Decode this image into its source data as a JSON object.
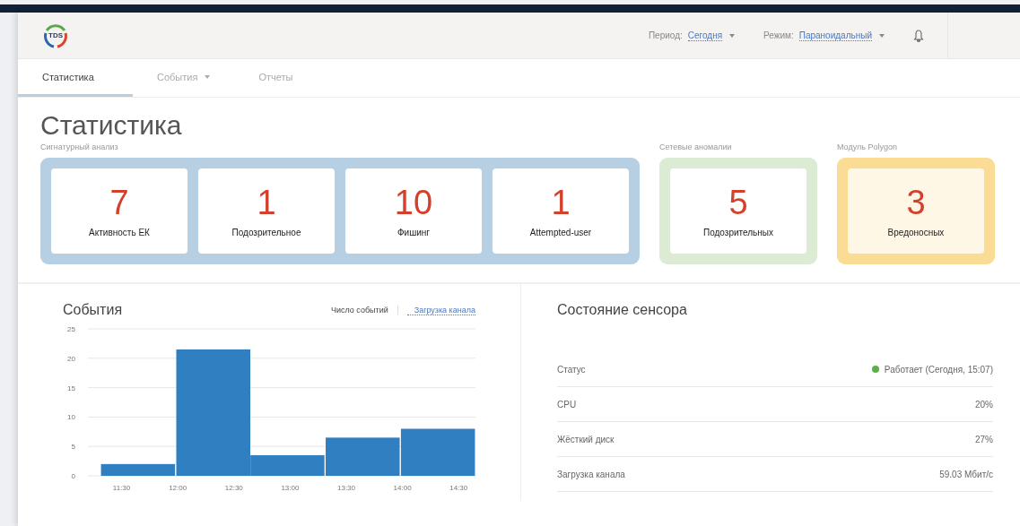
{
  "header": {
    "logo_text": "TDS",
    "period": {
      "label": "Период:",
      "value": "Сегодня"
    },
    "mode": {
      "label": "Режим:",
      "value": "Параноидальный"
    }
  },
  "tabs": [
    {
      "label": "Статистика",
      "selected": true,
      "dropdown": false
    },
    {
      "label": "События",
      "selected": false,
      "dropdown": true
    },
    {
      "label": "Отчеты",
      "selected": false,
      "dropdown": false
    }
  ],
  "page_title": "Статистика",
  "groups": [
    {
      "title": "Сигнатурный анализ",
      "color": "#b7cfe2",
      "cards": [
        {
          "value": "7",
          "label": "Активность ЕК"
        },
        {
          "value": "1",
          "label": "Подозрительное"
        },
        {
          "value": "10",
          "label": "Фишинг"
        },
        {
          "value": "1",
          "label": "Attempted-user"
        }
      ]
    },
    {
      "title": "Сетевые аномалии",
      "color": "#dcebd3",
      "cards": [
        {
          "value": "5",
          "label": "Подозрительных"
        }
      ]
    },
    {
      "title": "Модуль Polygon",
      "color": "#fbdc95",
      "cards": [
        {
          "value": "3",
          "label": "Вредоносных"
        }
      ]
    }
  ],
  "events": {
    "title": "События",
    "toggles": [
      {
        "label": "Число событий",
        "selected": true
      },
      {
        "label": "Загрузка канала",
        "selected": false
      }
    ],
    "chart_data": {
      "type": "bar",
      "x": [
        11.65,
        12.32,
        12.98,
        13.65,
        14.32
      ],
      "series": [
        {
          "color": "#2f7fc1",
          "values": [
            2,
            21.5,
            3.5,
            6.5,
            8
          ]
        }
      ],
      "grid": true,
      "xlim": [
        11.2,
        14.65
      ],
      "ylim": [
        0,
        25
      ],
      "xticks": [
        {
          "value": 11.5,
          "label": "11:30"
        },
        {
          "value": 12,
          "label": "12:00"
        },
        {
          "value": 12.5,
          "label": "12:30"
        },
        {
          "value": 13,
          "label": "13:00"
        },
        {
          "value": 13.5,
          "label": "13:30"
        },
        {
          "value": 14,
          "label": "14:00"
        },
        {
          "value": 14.5,
          "label": "14:30"
        }
      ],
      "yticks": [
        0,
        5,
        10,
        15,
        20,
        25
      ]
    }
  },
  "sensor": {
    "title": "Состояние сенсора",
    "rows": [
      {
        "kind": "status",
        "label": "Статус",
        "value": "Работает (Сегодня, 15:07)",
        "color": "#5cb04a"
      },
      {
        "kind": "plain",
        "label": "CPU",
        "value": "20%"
      },
      {
        "kind": "plain",
        "label": "Жёсткий диск",
        "value": "27%"
      },
      {
        "kind": "plain",
        "label": "Загрузка канала",
        "value": "59.03 Мбит/с"
      }
    ]
  }
}
